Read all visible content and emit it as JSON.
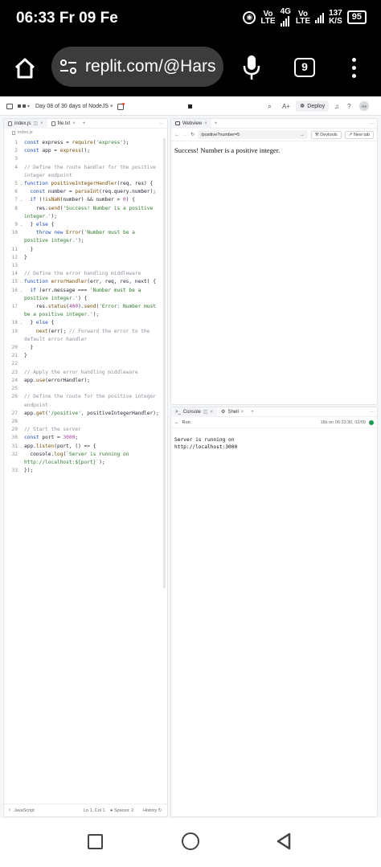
{
  "status_bar": {
    "time": "06:33",
    "day": "Fr",
    "date": "09",
    "month": "Fe",
    "net1_top": "Vo",
    "net1_bottom": "LTE",
    "net2_gen": "4G",
    "net3_top": "Vo",
    "net3_bottom": "LTE",
    "speed_value": "137",
    "speed_unit": "K/S",
    "battery": "95"
  },
  "browser": {
    "url": "replit.com/@Hars",
    "tab_count": "9"
  },
  "ide": {
    "project_title": "Day 08 of 30 days of NodeJS",
    "deploy_label": "Deploy",
    "avatar_initials": "HS",
    "editor": {
      "tabs": [
        {
          "label": "index.js"
        },
        {
          "label": "file.txt"
        }
      ],
      "breadcrumb": "index.js",
      "lines": [
        {
          "n": "1",
          "fold": "",
          "html": "<span class=\"kw\">const</span> express = <span class=\"fn\">require</span>(<span class=\"str\">'express'</span>);"
        },
        {
          "n": "2",
          "fold": "",
          "html": "<span class=\"kw\">const</span> app = <span class=\"fn\">express</span>();"
        },
        {
          "n": "3",
          "fold": "",
          "html": ""
        },
        {
          "n": "4",
          "fold": "",
          "html": "<span class=\"cmt\">// Define the route handler for the positive integer endpoint</span>"
        },
        {
          "n": "5",
          "fold": "⌄",
          "html": "<span class=\"kw\">function</span> <span class=\"fn\">positiveIntegerHandler</span>(req, res) {"
        },
        {
          "n": "6",
          "fold": "",
          "html": "  <span class=\"kw\">const</span> number = <span class=\"fn\">parseInt</span>(req.query.number);"
        },
        {
          "n": "7",
          "fold": "⌄",
          "html": "  <span class=\"kw\">if</span> (!<span class=\"fn\">isNaN</span>(number) &amp;&amp; number &gt; <span class=\"num\">0</span>) {"
        },
        {
          "n": "8",
          "fold": "",
          "html": "    res.<span class=\"fn\">send</span>(<span class=\"str\">'Success! Number is a positive integer.'</span>);"
        },
        {
          "n": "9",
          "fold": "⌄",
          "html": "  } <span class=\"kw\">else</span> {"
        },
        {
          "n": "10",
          "fold": "",
          "html": "    <span class=\"kw\">throw new</span> <span class=\"fn\">Error</span>(<span class=\"str\">'Number must be a positive integer.'</span>);"
        },
        {
          "n": "11",
          "fold": "",
          "html": "  }"
        },
        {
          "n": "12",
          "fold": "",
          "html": "}"
        },
        {
          "n": "13",
          "fold": "",
          "html": ""
        },
        {
          "n": "14",
          "fold": "",
          "html": "<span class=\"cmt\">// Define the error handling middleware</span>"
        },
        {
          "n": "15",
          "fold": "⌄",
          "html": "<span class=\"kw\">function</span> <span class=\"fn\">errorHandler</span>(err, req, res, next) {"
        },
        {
          "n": "16",
          "fold": "⌄",
          "html": "  <span class=\"kw\">if</span> (err.message === <span class=\"str\">'Number must be a positive integer.'</span>) {"
        },
        {
          "n": "17",
          "fold": "",
          "html": "    res.<span class=\"fn\">status</span>(<span class=\"num\">400</span>).<span class=\"fn\">send</span>(<span class=\"str\">'Error: Number must be a positive integer.'</span>);"
        },
        {
          "n": "18",
          "fold": "⌄",
          "html": "  } <span class=\"kw\">else</span> {"
        },
        {
          "n": "19",
          "fold": "",
          "html": "    <span class=\"fn\">next</span>(err); <span class=\"cmt\">// Forward the error to the default error handler</span>"
        },
        {
          "n": "20",
          "fold": "",
          "html": "  }"
        },
        {
          "n": "21",
          "fold": "",
          "html": "}"
        },
        {
          "n": "22",
          "fold": "",
          "html": ""
        },
        {
          "n": "23",
          "fold": "",
          "html": "<span class=\"cmt\">// Apply the error handling middleware</span>"
        },
        {
          "n": "24",
          "fold": "",
          "html": "app.<span class=\"fn\">use</span>(errorHandler);"
        },
        {
          "n": "25",
          "fold": "",
          "html": ""
        },
        {
          "n": "26",
          "fold": "",
          "html": "<span class=\"cmt\">// Define the route for the positive integer endpoint</span>"
        },
        {
          "n": "27",
          "fold": "",
          "html": "app.<span class=\"fn\">get</span>(<span class=\"str\">'/positive'</span>, positiveIntegerHandler);"
        },
        {
          "n": "28",
          "fold": "",
          "html": ""
        },
        {
          "n": "29",
          "fold": "",
          "html": "<span class=\"cmt\">// Start the server</span>"
        },
        {
          "n": "30",
          "fold": "",
          "html": "<span class=\"kw\">const</span> port = <span class=\"num\">3000</span>;"
        },
        {
          "n": "31",
          "fold": "⌄",
          "html": "app.<span class=\"fn\">listen</span>(port, () =&gt; {"
        },
        {
          "n": "32",
          "fold": "",
          "html": "  console.<span class=\"fn\">log</span>(<span class=\"str\">`Server is running on http://localhost:${port}`</span>);"
        },
        {
          "n": "33",
          "fold": "",
          "html": "});"
        }
      ],
      "status": {
        "language": "JavaScript",
        "position": "Ln 1, Col 1",
        "spaces": "Spaces: 2",
        "history": "History"
      }
    },
    "webview": {
      "tab_label": "Webview",
      "url_path": "/positive?number=5",
      "devtools_label": "Devtools",
      "new_tab_label": "New tab",
      "body_text": "Success! Number is a positive integer."
    },
    "console": {
      "tab_console": "Console",
      "tab_shell": "Shell",
      "run_label": "Run",
      "timestamp": "18s on 06:33:30, 02/09",
      "output": "Server is running on http://localhost:3000"
    }
  }
}
